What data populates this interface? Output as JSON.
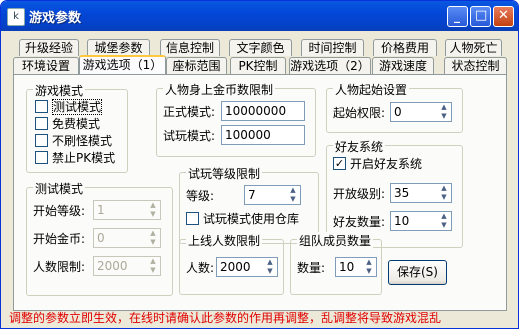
{
  "window": {
    "title": "游戏参数",
    "minimize_glyph": "_",
    "maximize_glyph": "□",
    "close_glyph": "✕"
  },
  "tabs_row1": [
    "升级经验",
    "城堡参数",
    "信息控制",
    "文字颜色",
    "时间控制",
    "价格费用",
    "人物死亡"
  ],
  "tabs_row2": [
    "环境设置",
    "游戏选项（1）",
    "座标范围",
    "PK控制",
    "游戏选项（2）",
    "游戏速度",
    "状态控制"
  ],
  "active_tab": "游戏选项（1）",
  "game_mode": {
    "title": "游戏模式",
    "options": [
      {
        "label": "测试模式",
        "checked": false
      },
      {
        "label": "免费模式",
        "checked": false
      },
      {
        "label": "不刷怪模式",
        "checked": false
      },
      {
        "label": "禁止PK模式",
        "checked": false
      }
    ]
  },
  "gold_limit": {
    "title": "人物身上金币数限制",
    "formal_label": "正式模式:",
    "formal_value": "10000000",
    "trial_label": "试玩模式:",
    "trial_value": "100000"
  },
  "start_setting": {
    "title": "人物起始设置",
    "perm_label": "起始权限:",
    "perm_value": "0"
  },
  "test_mode": {
    "title": "测试模式",
    "level_label": "开始等级:",
    "level_value": "1",
    "gold_label": "开始金币:",
    "gold_value": "0",
    "people_label": "人数限制:",
    "people_value": "2000"
  },
  "trial_level": {
    "title": "试玩等级限制",
    "level_label": "等级:",
    "level_value": "7",
    "storage_label": "试玩模式使用仓库",
    "storage_checked": false
  },
  "online_limit": {
    "title": "上线人数限制",
    "people_label": "人数:",
    "people_value": "2000"
  },
  "friend_system": {
    "title": "好友系统",
    "enable_label": "开启好友系统",
    "enable_checked": true,
    "open_level_label": "开放级别:",
    "open_level_value": "35",
    "count_label": "好友数量:",
    "count_value": "10"
  },
  "team": {
    "title": "组队成员数量",
    "count_label": "数量:",
    "count_value": "10"
  },
  "save_button": "保存(S)",
  "status_message": "调整的参数立即生效，在线时请确认此参数的作用再调整，乱调整将导致游戏混乱"
}
